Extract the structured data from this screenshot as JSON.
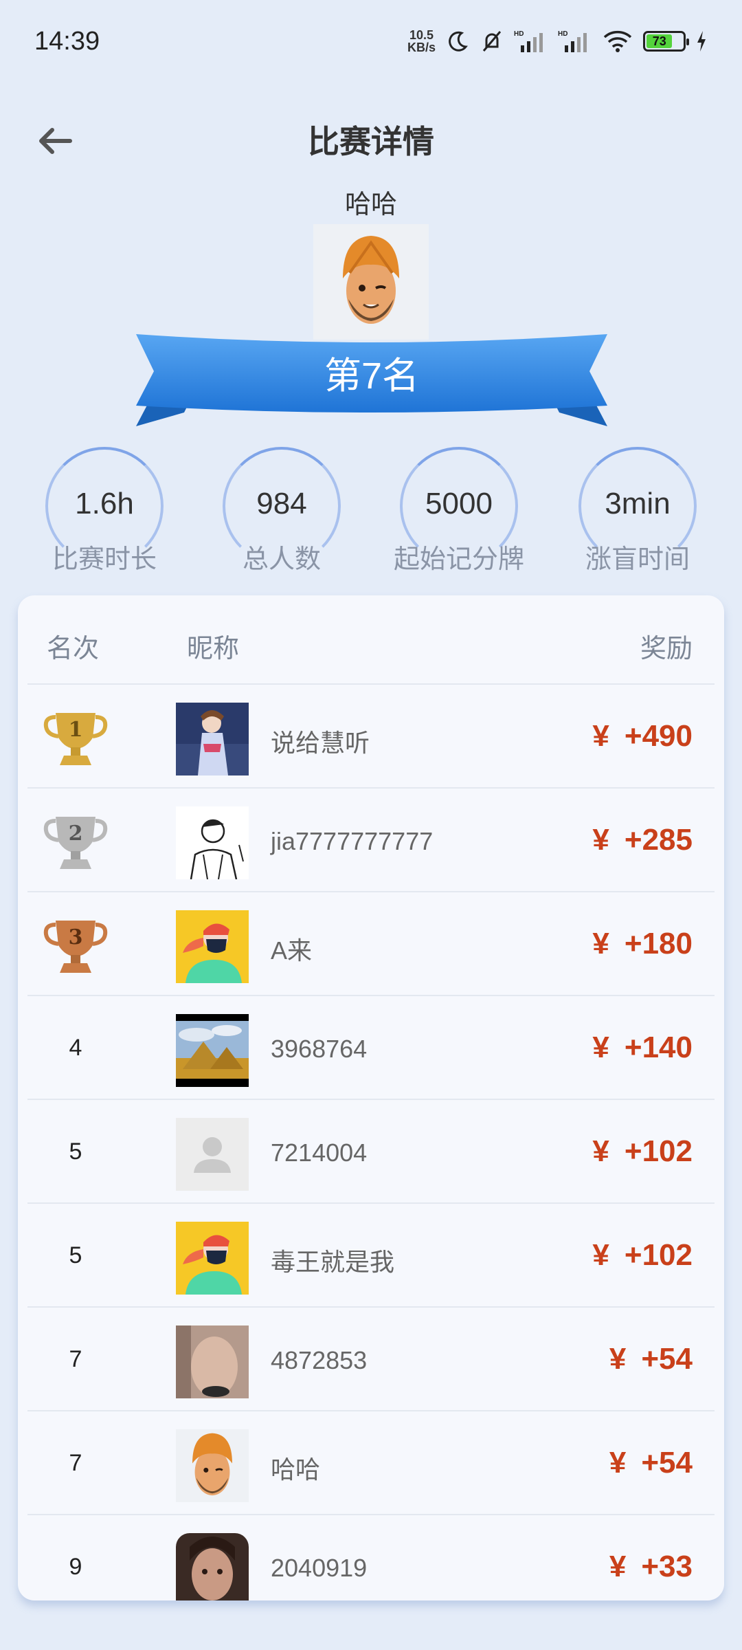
{
  "status_bar": {
    "time": "14:39",
    "net_speed_value": "10.5",
    "net_speed_unit": "KB/s",
    "battery_level": "73"
  },
  "header": {
    "title": "比赛详情"
  },
  "player": {
    "name": "哈哈",
    "rank_badge": "第7名"
  },
  "stats": [
    {
      "value": "1.6h",
      "label": "比赛时长"
    },
    {
      "value": "984",
      "label": "总人数"
    },
    {
      "value": "5000",
      "label": "起始记分牌"
    },
    {
      "value": "3min",
      "label": "涨盲时间"
    }
  ],
  "ranking": {
    "headers": {
      "rank": "名次",
      "nickname": "昵称",
      "reward": "奖励"
    },
    "currency": "¥",
    "rows": [
      {
        "rank": "1",
        "name": "说给慧听",
        "reward": "+490",
        "avatar": "photo-girl-kimono"
      },
      {
        "rank": "2",
        "name": "jia7777777777",
        "reward": "+285",
        "avatar": "sketch-man"
      },
      {
        "rank": "3",
        "name": "A来",
        "reward": "+180",
        "avatar": "masked-person-yellow"
      },
      {
        "rank": "4",
        "name": "3968764",
        "reward": "+140",
        "avatar": "pyramids"
      },
      {
        "rank": "5",
        "name": "7214004",
        "reward": "+102",
        "avatar": "default-user"
      },
      {
        "rank": "5",
        "name": "毒王就是我",
        "reward": "+102",
        "avatar": "masked-person-yellow"
      },
      {
        "rank": "7",
        "name": "4872853",
        "reward": "+54",
        "avatar": "photo-skin"
      },
      {
        "rank": "7",
        "name": "哈哈",
        "reward": "+54",
        "avatar": "turban-emoji"
      },
      {
        "rank": "9",
        "name": "2040919",
        "reward": "+33",
        "avatar": "photo-woman"
      }
    ]
  },
  "colors": {
    "background": "#e4ecf8",
    "reward": "#c9401a",
    "ribbon": "#2f86e3",
    "gold": "#d8aa3e",
    "silver": "#b8b8b8",
    "bronze": "#c97a44"
  }
}
